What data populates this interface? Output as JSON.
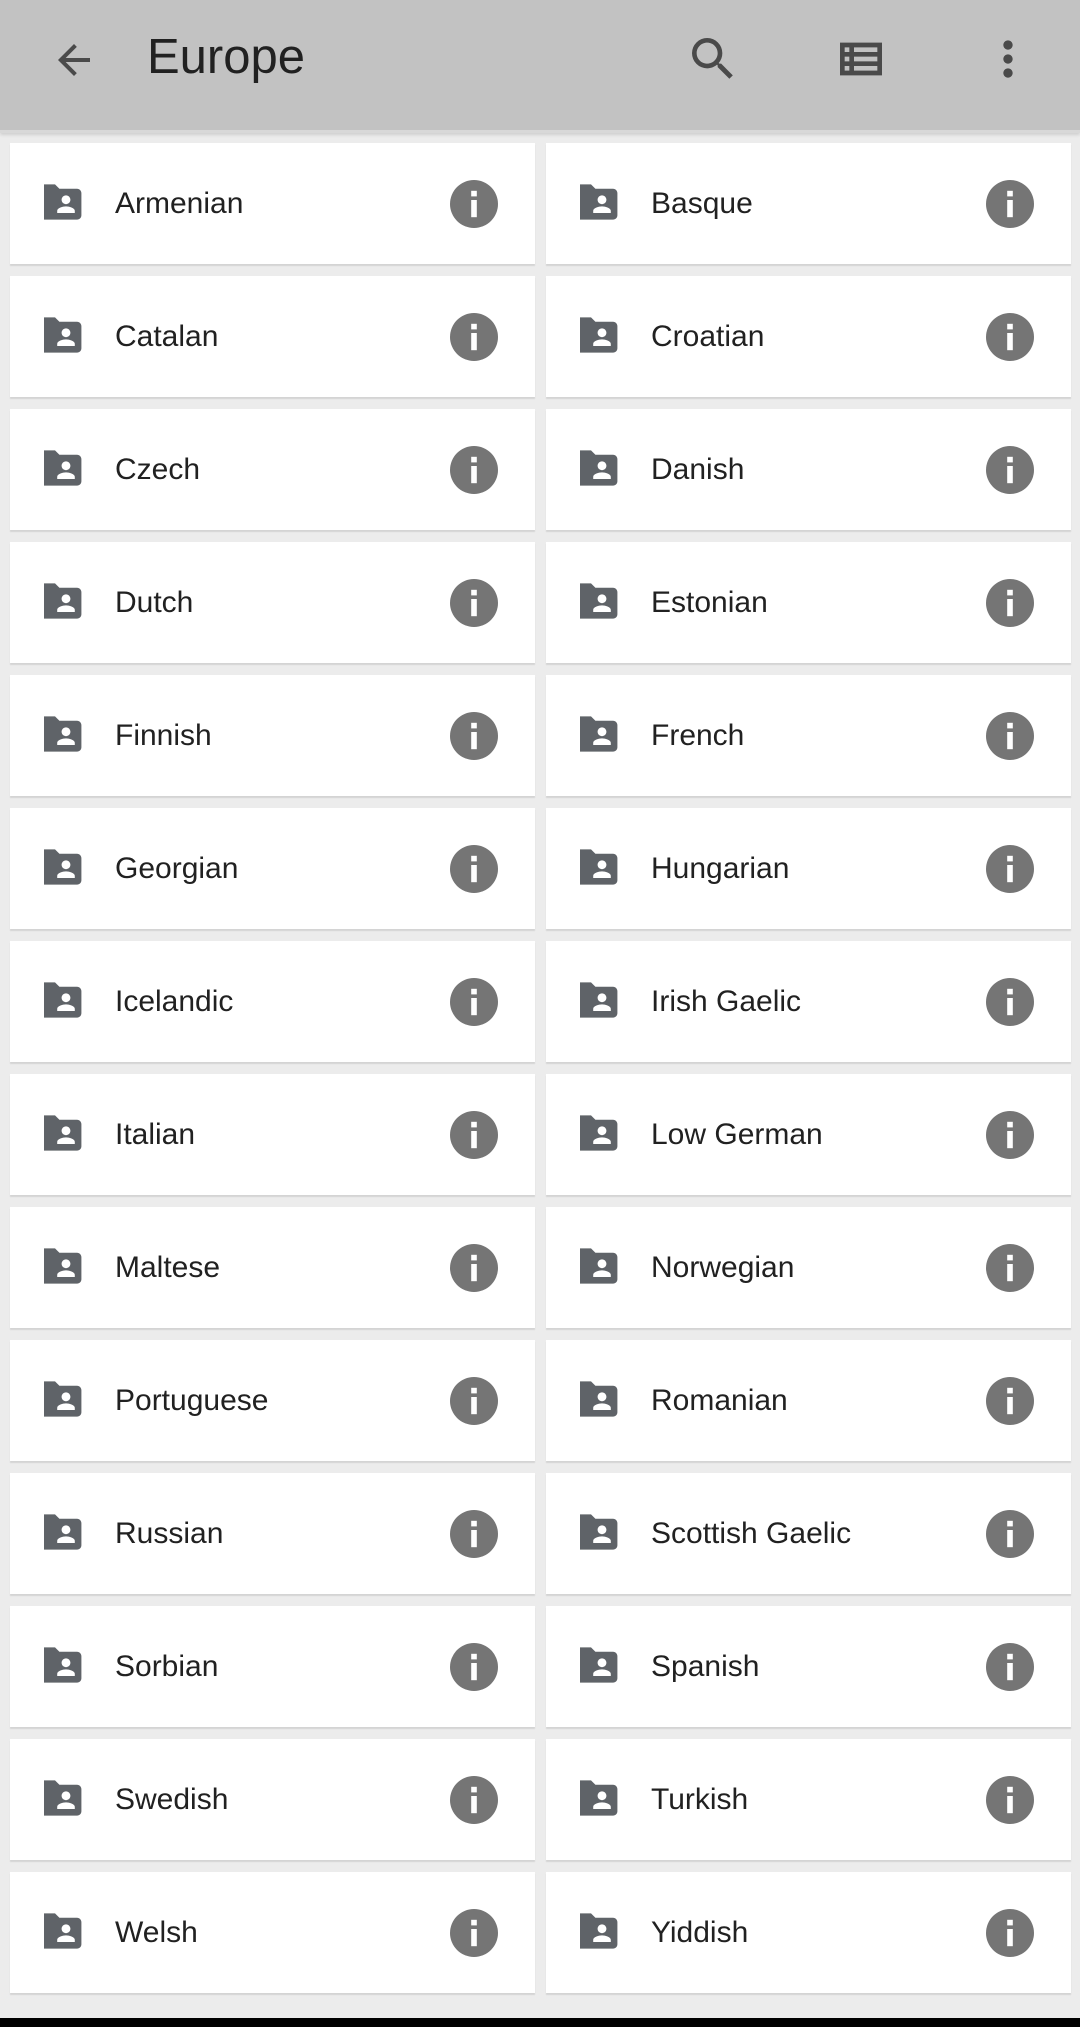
{
  "appbar": {
    "title": "Europe",
    "icons": {
      "back": "arrow-back-icon",
      "search": "search-icon",
      "view_toggle": "list-view-icon",
      "more": "more-vert-icon"
    }
  },
  "items": [
    {
      "label": "Armenian"
    },
    {
      "label": "Basque"
    },
    {
      "label": "Catalan"
    },
    {
      "label": "Croatian"
    },
    {
      "label": "Czech"
    },
    {
      "label": "Danish"
    },
    {
      "label": "Dutch"
    },
    {
      "label": "Estonian"
    },
    {
      "label": "Finnish"
    },
    {
      "label": "French"
    },
    {
      "label": "Georgian"
    },
    {
      "label": "Hungarian"
    },
    {
      "label": "Icelandic"
    },
    {
      "label": "Irish Gaelic"
    },
    {
      "label": "Italian"
    },
    {
      "label": "Low German"
    },
    {
      "label": "Maltese"
    },
    {
      "label": "Norwegian"
    },
    {
      "label": "Portuguese"
    },
    {
      "label": "Romanian"
    },
    {
      "label": "Russian"
    },
    {
      "label": "Scottish Gaelic"
    },
    {
      "label": "Sorbian"
    },
    {
      "label": "Spanish"
    },
    {
      "label": "Swedish"
    },
    {
      "label": "Turkish"
    },
    {
      "label": "Welsh"
    },
    {
      "label": "Yiddish"
    }
  ],
  "colors": {
    "appbar_bg": "#c2c2c2",
    "icon": "#4a4a4a",
    "folder_icon": "#5f6368",
    "info_icon": "#757575",
    "text": "#212121",
    "page_bg": "#ececec"
  }
}
